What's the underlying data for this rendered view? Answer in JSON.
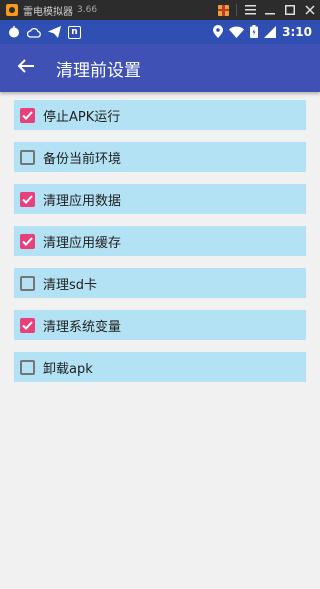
{
  "emulator": {
    "title": "雷电模拟器",
    "version": "3.66",
    "icons": [
      "ldplayer-logo-icon",
      "gift-icon",
      "menu-icon",
      "minimize-icon",
      "maximize-icon",
      "close-icon"
    ]
  },
  "status_bar": {
    "time": "3:10",
    "icons": [
      "app-dot-icon",
      "cloud-icon",
      "send-icon",
      "n-app-icon",
      "location-icon",
      "wifi-icon",
      "battery-icon",
      "signal-icon"
    ]
  },
  "app_bar": {
    "title": "清理前设置",
    "back_icon": "arrow-back-icon",
    "color": "#3f51b5"
  },
  "options": [
    {
      "label": "停止APK运行",
      "checked": true
    },
    {
      "label": "备份当前环境",
      "checked": false
    },
    {
      "label": "清理应用数据",
      "checked": true
    },
    {
      "label": "清理应用缓存",
      "checked": true
    },
    {
      "label": "清理sd卡",
      "checked": false
    },
    {
      "label": "清理系统变量",
      "checked": true
    },
    {
      "label": "卸载apk",
      "checked": false
    }
  ],
  "colors": {
    "status_bar": "#2f4fb3",
    "row_background": "#b4e2f5",
    "checkbox_checked": "#e8407a",
    "page_background": "#f1f1f1"
  }
}
